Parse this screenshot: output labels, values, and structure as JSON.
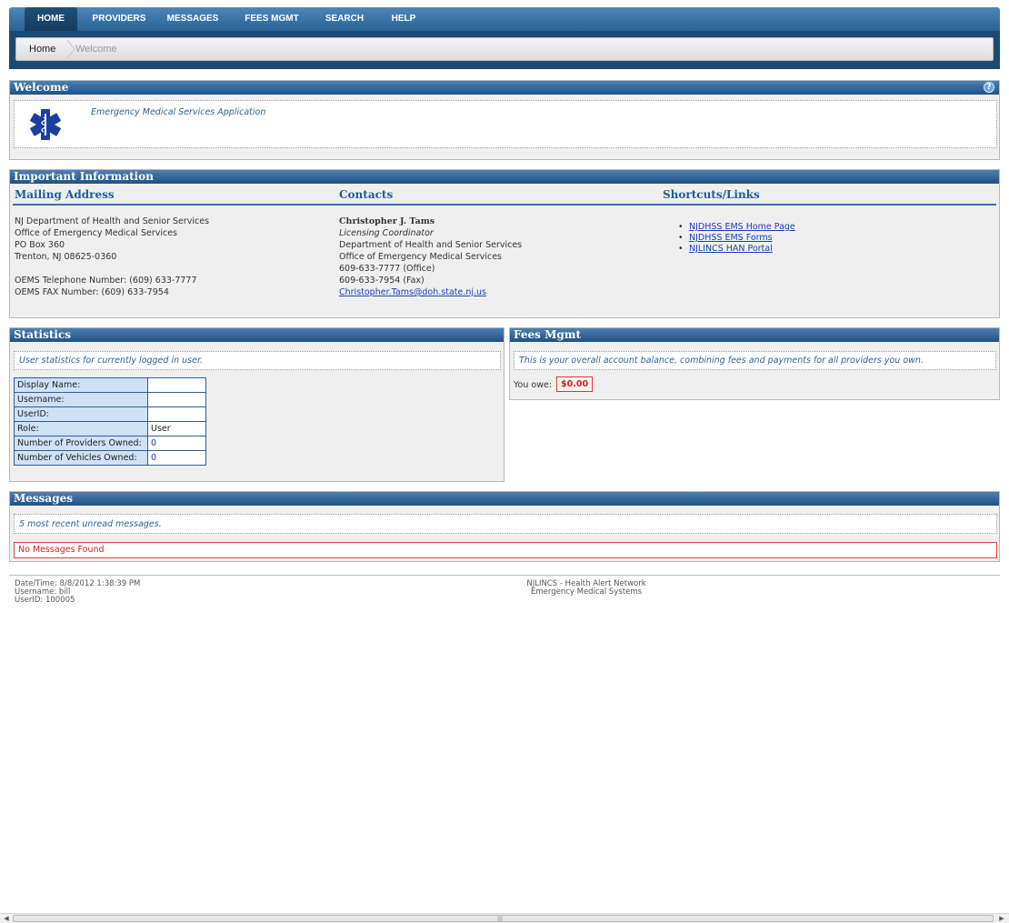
{
  "nav": {
    "tabs": [
      {
        "label": "HOME",
        "active": true
      },
      {
        "label": "PROVIDERS",
        "active": false
      },
      {
        "label": "MESSAGES",
        "active": false
      },
      {
        "label": "FEES MGMT",
        "active": false
      },
      {
        "label": "SEARCH",
        "active": false
      },
      {
        "label": "HELP",
        "active": false
      }
    ]
  },
  "breadcrumb": {
    "home": "Home",
    "current": "Welcome"
  },
  "welcome": {
    "title": "Welcome",
    "help_icon": "question-circle-icon",
    "logo_icon": "star-of-life-icon",
    "app_name": "Emergency Medical Services Application"
  },
  "info": {
    "title": "Important Information",
    "mailing": {
      "heading": "Mailing Address",
      "lines": [
        "NJ Department of Health and Senior Services",
        "Office of Emergency Medical Services",
        "PO Box 360",
        "Trenton, NJ 08625-0360"
      ],
      "phone": "OEMS Telephone Number: (609) 633-7777",
      "fax": "OEMS FAX Number: (609) 633-7954"
    },
    "contacts": {
      "heading": "Contacts",
      "name": "Christopher J. Tams",
      "role": "Licensing Coordinator",
      "lines": [
        "Department of Health and Senior Services",
        "Office of Emergency Medical Services",
        "609-633-7777 (Office)",
        "609-633-7954 (Fax)"
      ],
      "email": "Christopher.Tams@doh.state.nj.us"
    },
    "shortcuts": {
      "heading": "Shortcuts/Links",
      "links": [
        "NJDHSS EMS Home Page",
        "NJDHSS EMS Forms",
        "NJLINCS HAN Portal"
      ]
    }
  },
  "statistics": {
    "title": "Statistics",
    "note": "User statistics for currently logged in user.",
    "rows": [
      {
        "label": "Display Name:",
        "value": ""
      },
      {
        "label": "Username:",
        "value": ""
      },
      {
        "label": "UserID:",
        "value": ""
      },
      {
        "label": "Role:",
        "value": "User"
      },
      {
        "label": "Number of Providers Owned:",
        "value": "0"
      },
      {
        "label": "Number of Vehicles Owned:",
        "value": "0"
      }
    ]
  },
  "fees": {
    "title": "Fees Mgmt",
    "note": "This is your overall account balance, combining fees and payments for all providers you own.",
    "owe_label": "You owe:",
    "owe_value": "$0.00"
  },
  "messages": {
    "title": "Messages",
    "note": "5 most recent unread messages.",
    "empty": "No Messages Found"
  },
  "footer": {
    "datetime": "Date/Time: 8/8/2012 1:38:39 PM",
    "username": "Username: bill",
    "userid": "UserID: 100005",
    "center_line1": "NJLINCS - Health Alert Network",
    "center_line2": "Emergency Medical Systems"
  },
  "colors": {
    "header_blue": "#1f5185",
    "link": "#1a3fb8",
    "alert_red": "#d62020",
    "panel_bg": "#efeff0"
  }
}
